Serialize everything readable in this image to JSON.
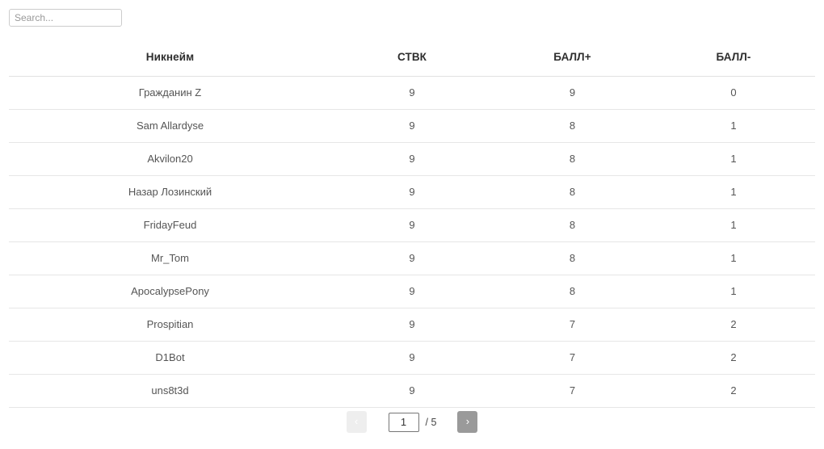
{
  "search": {
    "placeholder": "Search...",
    "value": ""
  },
  "table": {
    "columns": [
      {
        "key": "nickname",
        "label": "Никнейм"
      },
      {
        "key": "stvk",
        "label": "СТВК"
      },
      {
        "key": "plus",
        "label": "БАЛЛ+"
      },
      {
        "key": "minus",
        "label": "БАЛЛ-"
      }
    ],
    "rows": [
      {
        "nickname": "Гражданин Z",
        "stvk": "9",
        "plus": "9",
        "minus": "0"
      },
      {
        "nickname": "Sam Allardyse",
        "stvk": "9",
        "plus": "8",
        "minus": "1"
      },
      {
        "nickname": "Akvilon20",
        "stvk": "9",
        "plus": "8",
        "minus": "1"
      },
      {
        "nickname": "Назар Лозинский",
        "stvk": "9",
        "plus": "8",
        "minus": "1"
      },
      {
        "nickname": "FridayFeud",
        "stvk": "9",
        "plus": "8",
        "minus": "1"
      },
      {
        "nickname": "Mr_Tom",
        "stvk": "9",
        "plus": "8",
        "minus": "1"
      },
      {
        "nickname": "ApocalypsePony",
        "stvk": "9",
        "plus": "8",
        "minus": "1"
      },
      {
        "nickname": "Prospitian",
        "stvk": "9",
        "plus": "7",
        "minus": "2"
      },
      {
        "nickname": "D1Bot",
        "stvk": "9",
        "plus": "7",
        "minus": "2"
      },
      {
        "nickname": "uns8t3d",
        "stvk": "9",
        "plus": "7",
        "minus": "2"
      }
    ]
  },
  "pagination": {
    "prev_label": "‹",
    "next_label": "›",
    "current_page": "1",
    "total_label": "/ 5",
    "total_pages": "5",
    "prev_disabled": true
  },
  "colors": {
    "page_background": "#ffffff",
    "header_text": "#2e2e2e",
    "body_text": "#555555",
    "row_border": "#e6e6e6",
    "header_border": "#e2e2e2",
    "input_border": "#cccccc",
    "placeholder_text": "#999999",
    "pager_active": "#9a9a9a",
    "pager_disabled": "#eeeeee"
  }
}
